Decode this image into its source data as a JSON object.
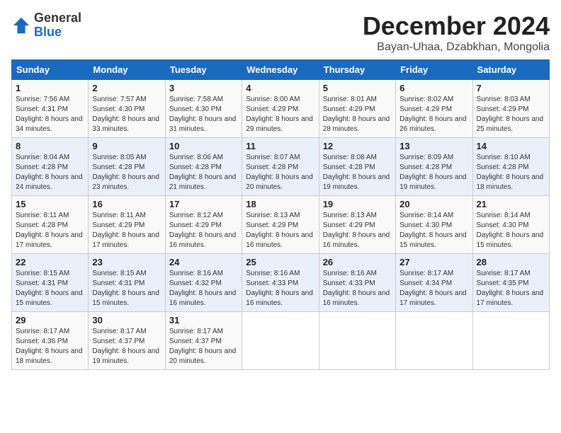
{
  "logo": {
    "general": "General",
    "blue": "Blue"
  },
  "title": "December 2024",
  "subtitle": "Bayan-Uhaa, Dzabkhan, Mongolia",
  "headers": [
    "Sunday",
    "Monday",
    "Tuesday",
    "Wednesday",
    "Thursday",
    "Friday",
    "Saturday"
  ],
  "weeks": [
    [
      {
        "day": "1",
        "sunrise": "7:56 AM",
        "sunset": "4:31 PM",
        "daylight": "8 hours and 34 minutes."
      },
      {
        "day": "2",
        "sunrise": "7:57 AM",
        "sunset": "4:30 PM",
        "daylight": "8 hours and 33 minutes."
      },
      {
        "day": "3",
        "sunrise": "7:58 AM",
        "sunset": "4:30 PM",
        "daylight": "8 hours and 31 minutes."
      },
      {
        "day": "4",
        "sunrise": "8:00 AM",
        "sunset": "4:29 PM",
        "daylight": "8 hours and 29 minutes."
      },
      {
        "day": "5",
        "sunrise": "8:01 AM",
        "sunset": "4:29 PM",
        "daylight": "8 hours and 28 minutes."
      },
      {
        "day": "6",
        "sunrise": "8:02 AM",
        "sunset": "4:29 PM",
        "daylight": "8 hours and 26 minutes."
      },
      {
        "day": "7",
        "sunrise": "8:03 AM",
        "sunset": "4:29 PM",
        "daylight": "8 hours and 25 minutes."
      }
    ],
    [
      {
        "day": "8",
        "sunrise": "8:04 AM",
        "sunset": "4:28 PM",
        "daylight": "8 hours and 24 minutes."
      },
      {
        "day": "9",
        "sunrise": "8:05 AM",
        "sunset": "4:28 PM",
        "daylight": "8 hours and 23 minutes."
      },
      {
        "day": "10",
        "sunrise": "8:06 AM",
        "sunset": "4:28 PM",
        "daylight": "8 hours and 21 minutes."
      },
      {
        "day": "11",
        "sunrise": "8:07 AM",
        "sunset": "4:28 PM",
        "daylight": "8 hours and 20 minutes."
      },
      {
        "day": "12",
        "sunrise": "8:08 AM",
        "sunset": "4:28 PM",
        "daylight": "8 hours and 19 minutes."
      },
      {
        "day": "13",
        "sunrise": "8:09 AM",
        "sunset": "4:28 PM",
        "daylight": "8 hours and 19 minutes."
      },
      {
        "day": "14",
        "sunrise": "8:10 AM",
        "sunset": "4:28 PM",
        "daylight": "8 hours and 18 minutes."
      }
    ],
    [
      {
        "day": "15",
        "sunrise": "8:11 AM",
        "sunset": "4:28 PM",
        "daylight": "8 hours and 17 minutes."
      },
      {
        "day": "16",
        "sunrise": "8:11 AM",
        "sunset": "4:29 PM",
        "daylight": "8 hours and 17 minutes."
      },
      {
        "day": "17",
        "sunrise": "8:12 AM",
        "sunset": "4:29 PM",
        "daylight": "8 hours and 16 minutes."
      },
      {
        "day": "18",
        "sunrise": "8:13 AM",
        "sunset": "4:29 PM",
        "daylight": "8 hours and 16 minutes."
      },
      {
        "day": "19",
        "sunrise": "8:13 AM",
        "sunset": "4:29 PM",
        "daylight": "8 hours and 16 minutes."
      },
      {
        "day": "20",
        "sunrise": "8:14 AM",
        "sunset": "4:30 PM",
        "daylight": "8 hours and 15 minutes."
      },
      {
        "day": "21",
        "sunrise": "8:14 AM",
        "sunset": "4:30 PM",
        "daylight": "8 hours and 15 minutes."
      }
    ],
    [
      {
        "day": "22",
        "sunrise": "8:15 AM",
        "sunset": "4:31 PM",
        "daylight": "8 hours and 15 minutes."
      },
      {
        "day": "23",
        "sunrise": "8:15 AM",
        "sunset": "4:31 PM",
        "daylight": "8 hours and 15 minutes."
      },
      {
        "day": "24",
        "sunrise": "8:16 AM",
        "sunset": "4:32 PM",
        "daylight": "8 hours and 16 minutes."
      },
      {
        "day": "25",
        "sunrise": "8:16 AM",
        "sunset": "4:33 PM",
        "daylight": "8 hours and 16 minutes."
      },
      {
        "day": "26",
        "sunrise": "8:16 AM",
        "sunset": "4:33 PM",
        "daylight": "8 hours and 16 minutes."
      },
      {
        "day": "27",
        "sunrise": "8:17 AM",
        "sunset": "4:34 PM",
        "daylight": "8 hours and 17 minutes."
      },
      {
        "day": "28",
        "sunrise": "8:17 AM",
        "sunset": "4:35 PM",
        "daylight": "8 hours and 17 minutes."
      }
    ],
    [
      {
        "day": "29",
        "sunrise": "8:17 AM",
        "sunset": "4:36 PM",
        "daylight": "8 hours and 18 minutes."
      },
      {
        "day": "30",
        "sunrise": "8:17 AM",
        "sunset": "4:37 PM",
        "daylight": "8 hours and 19 minutes."
      },
      {
        "day": "31",
        "sunrise": "8:17 AM",
        "sunset": "4:37 PM",
        "daylight": "8 hours and 20 minutes."
      },
      null,
      null,
      null,
      null
    ]
  ]
}
